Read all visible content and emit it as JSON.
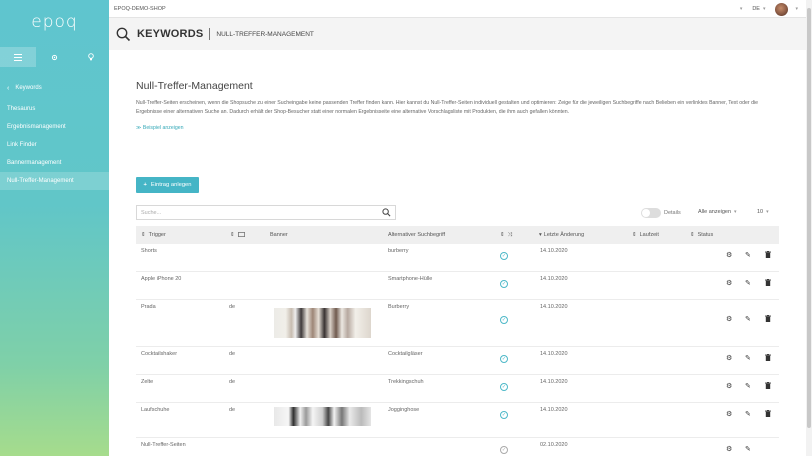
{
  "sidebar": {
    "logo": "epoq",
    "tabs": [
      "menu-icon",
      "gear-icon",
      "bulb-icon"
    ],
    "back_label": "Keywords",
    "items": [
      {
        "label": "Thesaurus",
        "active": false
      },
      {
        "label": "Ergebnismanagement",
        "active": false
      },
      {
        "label": "Link Finder",
        "active": false
      },
      {
        "label": "Bannermanagement",
        "active": false
      },
      {
        "label": "Null-Treffer-Management",
        "active": true
      }
    ]
  },
  "topbar": {
    "shop_name": "EPOQ-DEMO-SHOP",
    "language": "DE"
  },
  "header": {
    "title": "KEYWORDS",
    "subtitle": "NULL-TREFFER-MANAGEMENT"
  },
  "main": {
    "page_title": "Null-Treffer-Management",
    "description": "Null-Treffer-Seiten erscheinen, wenn die Shopsuche zu einer Sucheingabe keine passenden Treffer finden kann. Hier kannst du Null-Treffer-Seiten individuell gestalten und optimieren: Zeige für die jeweiligen Suchbegriffe nach Belieben ein verlinktes Banner, Text oder die Ergebnisse einer alternativen Suche an. Dadurch erhält der Shop-Besucher statt einer normalen Ergebnisseite eine alternative Vorschlagsliste mit Produkten, die ihm auch gefallen könnten.",
    "example_link": "Beispiel anzeigen",
    "add_button": "Eintrag anlegen",
    "search_placeholder": "Suche...",
    "details_label": "Details",
    "show_all_label": "Alle anzeigen",
    "per_page": "10"
  },
  "table": {
    "columns": {
      "trigger": "Trigger",
      "banner": "Banner",
      "alt_term": "Alternativer Suchbegriff",
      "last_change": "Letzte Änderung",
      "runtime": "Laufzeit",
      "status": "Status"
    },
    "rows": [
      {
        "trigger": "Shorts",
        "lang": "",
        "banner": "",
        "alt_term": "burberry",
        "date": "14.10.2020",
        "check_active": true,
        "status_on": true
      },
      {
        "trigger": "Apple iPhone 20",
        "lang": "",
        "banner": "",
        "alt_term": "Smartphone-Hülle",
        "date": "14.10.2020",
        "check_active": true,
        "status_on": true
      },
      {
        "trigger": "Prada",
        "lang": "de",
        "banner": "clothes-rack",
        "alt_term": "Burberry",
        "date": "14.10.2020",
        "check_active": true,
        "status_on": true
      },
      {
        "trigger": "Cocktailshaker",
        "lang": "de",
        "banner": "",
        "alt_term": "Cocktailgläser",
        "date": "14.10.2020",
        "check_active": true,
        "status_on": true
      },
      {
        "trigger": "Zelte",
        "lang": "de",
        "banner": "",
        "alt_term": "Trekkingschuh",
        "date": "14.10.2020",
        "check_active": true,
        "status_on": true
      },
      {
        "trigger": "Laufschuhe",
        "lang": "de",
        "banner": "shoes-bw",
        "alt_term": "Jogginghose",
        "date": "14.10.2020",
        "check_active": true,
        "status_on": true
      },
      {
        "trigger": "Null-Treffer-Seiten",
        "lang": "",
        "banner": "",
        "alt_term": "",
        "date": "02.10.2020",
        "check_active": false,
        "status_on": true
      }
    ]
  }
}
